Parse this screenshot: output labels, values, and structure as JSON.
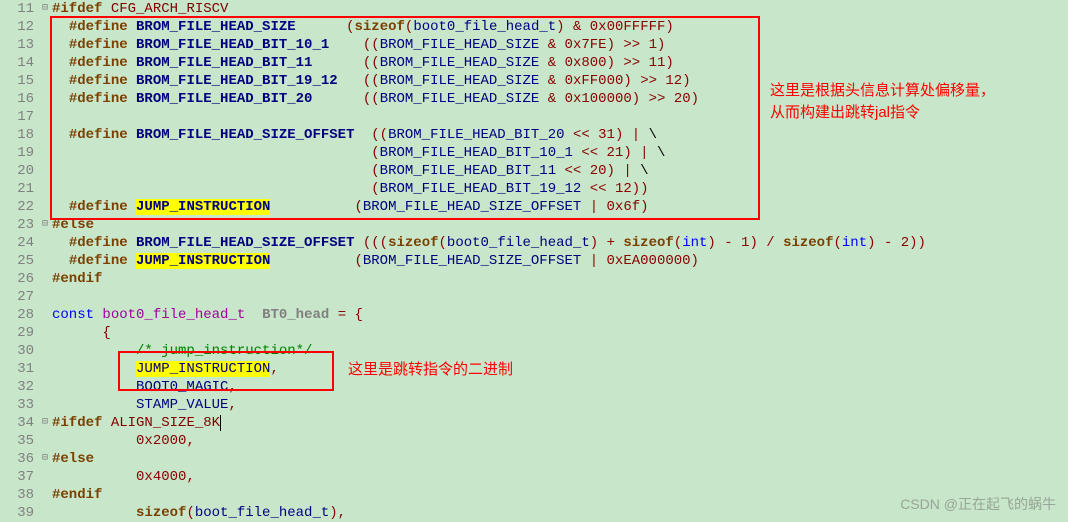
{
  "lines": [
    {
      "n": "11",
      "fold": "⊟",
      "tokens": [
        {
          "c": "kw",
          "t": "#ifdef"
        },
        {
          "c": "txt",
          "t": " "
        },
        {
          "c": "macro",
          "t": "CFG_ARCH_RISCV"
        }
      ]
    },
    {
      "n": "12",
      "fold": "",
      "tokens": [
        {
          "c": "txt",
          "t": "  "
        },
        {
          "c": "kw",
          "t": "#define"
        },
        {
          "c": "txt",
          "t": " "
        },
        {
          "c": "def-name",
          "t": "BROM_FILE_HEAD_SIZE"
        },
        {
          "c": "txt",
          "t": "      "
        },
        {
          "c": "paren",
          "t": "("
        },
        {
          "c": "kw",
          "t": "sizeof"
        },
        {
          "c": "paren",
          "t": "("
        },
        {
          "c": "id",
          "t": "boot0_file_head_t"
        },
        {
          "c": "paren",
          "t": ")"
        },
        {
          "c": "txt",
          "t": " "
        },
        {
          "c": "op",
          "t": "&"
        },
        {
          "c": "txt",
          "t": " "
        },
        {
          "c": "num",
          "t": "0x00FFFFF"
        },
        {
          "c": "paren",
          "t": ")"
        }
      ]
    },
    {
      "n": "13",
      "fold": "",
      "tokens": [
        {
          "c": "txt",
          "t": "  "
        },
        {
          "c": "kw",
          "t": "#define"
        },
        {
          "c": "txt",
          "t": " "
        },
        {
          "c": "def-name",
          "t": "BROM_FILE_HEAD_BIT_10_1"
        },
        {
          "c": "txt",
          "t": "    "
        },
        {
          "c": "paren",
          "t": "(("
        },
        {
          "c": "id",
          "t": "BROM_FILE_HEAD_SIZE"
        },
        {
          "c": "txt",
          "t": " "
        },
        {
          "c": "op",
          "t": "&"
        },
        {
          "c": "txt",
          "t": " "
        },
        {
          "c": "num",
          "t": "0x7FE"
        },
        {
          "c": "paren",
          "t": ")"
        },
        {
          "c": "txt",
          "t": " "
        },
        {
          "c": "op",
          "t": ">>"
        },
        {
          "c": "txt",
          "t": " "
        },
        {
          "c": "num",
          "t": "1"
        },
        {
          "c": "paren",
          "t": ")"
        }
      ]
    },
    {
      "n": "14",
      "fold": "",
      "tokens": [
        {
          "c": "txt",
          "t": "  "
        },
        {
          "c": "kw",
          "t": "#define"
        },
        {
          "c": "txt",
          "t": " "
        },
        {
          "c": "def-name",
          "t": "BROM_FILE_HEAD_BIT_11"
        },
        {
          "c": "txt",
          "t": "      "
        },
        {
          "c": "paren",
          "t": "(("
        },
        {
          "c": "id",
          "t": "BROM_FILE_HEAD_SIZE"
        },
        {
          "c": "txt",
          "t": " "
        },
        {
          "c": "op",
          "t": "&"
        },
        {
          "c": "txt",
          "t": " "
        },
        {
          "c": "num",
          "t": "0x800"
        },
        {
          "c": "paren",
          "t": ")"
        },
        {
          "c": "txt",
          "t": " "
        },
        {
          "c": "op",
          "t": ">>"
        },
        {
          "c": "txt",
          "t": " "
        },
        {
          "c": "num",
          "t": "11"
        },
        {
          "c": "paren",
          "t": ")"
        }
      ]
    },
    {
      "n": "15",
      "fold": "",
      "tokens": [
        {
          "c": "txt",
          "t": "  "
        },
        {
          "c": "kw",
          "t": "#define"
        },
        {
          "c": "txt",
          "t": " "
        },
        {
          "c": "def-name",
          "t": "BROM_FILE_HEAD_BIT_19_12"
        },
        {
          "c": "txt",
          "t": "   "
        },
        {
          "c": "paren",
          "t": "(("
        },
        {
          "c": "id",
          "t": "BROM_FILE_HEAD_SIZE"
        },
        {
          "c": "txt",
          "t": " "
        },
        {
          "c": "op",
          "t": "&"
        },
        {
          "c": "txt",
          "t": " "
        },
        {
          "c": "num",
          "t": "0xFF000"
        },
        {
          "c": "paren",
          "t": ")"
        },
        {
          "c": "txt",
          "t": " "
        },
        {
          "c": "op",
          "t": ">>"
        },
        {
          "c": "txt",
          "t": " "
        },
        {
          "c": "num",
          "t": "12"
        },
        {
          "c": "paren",
          "t": ")"
        }
      ]
    },
    {
      "n": "16",
      "fold": "",
      "tokens": [
        {
          "c": "txt",
          "t": "  "
        },
        {
          "c": "kw",
          "t": "#define"
        },
        {
          "c": "txt",
          "t": " "
        },
        {
          "c": "def-name",
          "t": "BROM_FILE_HEAD_BIT_20"
        },
        {
          "c": "txt",
          "t": "      "
        },
        {
          "c": "paren",
          "t": "(("
        },
        {
          "c": "id",
          "t": "BROM_FILE_HEAD_SIZE"
        },
        {
          "c": "txt",
          "t": " "
        },
        {
          "c": "op",
          "t": "&"
        },
        {
          "c": "txt",
          "t": " "
        },
        {
          "c": "num",
          "t": "0x100000"
        },
        {
          "c": "paren",
          "t": ")"
        },
        {
          "c": "txt",
          "t": " "
        },
        {
          "c": "op",
          "t": ">>"
        },
        {
          "c": "txt",
          "t": " "
        },
        {
          "c": "num",
          "t": "20"
        },
        {
          "c": "paren",
          "t": ")"
        }
      ]
    },
    {
      "n": "17",
      "fold": "",
      "tokens": []
    },
    {
      "n": "18",
      "fold": "",
      "tokens": [
        {
          "c": "txt",
          "t": "  "
        },
        {
          "c": "kw",
          "t": "#define"
        },
        {
          "c": "txt",
          "t": " "
        },
        {
          "c": "def-name",
          "t": "BROM_FILE_HEAD_SIZE_OFFSET"
        },
        {
          "c": "txt",
          "t": "  "
        },
        {
          "c": "paren",
          "t": "(("
        },
        {
          "c": "id",
          "t": "BROM_FILE_HEAD_BIT_20"
        },
        {
          "c": "txt",
          "t": " "
        },
        {
          "c": "op",
          "t": "<<"
        },
        {
          "c": "txt",
          "t": " "
        },
        {
          "c": "num",
          "t": "31"
        },
        {
          "c": "paren",
          "t": ")"
        },
        {
          "c": "txt",
          "t": " "
        },
        {
          "c": "op",
          "t": "|"
        },
        {
          "c": "txt",
          "t": " \\"
        }
      ]
    },
    {
      "n": "19",
      "fold": "",
      "tokens": [
        {
          "c": "txt",
          "t": "                                      "
        },
        {
          "c": "paren",
          "t": "("
        },
        {
          "c": "id",
          "t": "BROM_FILE_HEAD_BIT_10_1"
        },
        {
          "c": "txt",
          "t": " "
        },
        {
          "c": "op",
          "t": "<<"
        },
        {
          "c": "txt",
          "t": " "
        },
        {
          "c": "num",
          "t": "21"
        },
        {
          "c": "paren",
          "t": ")"
        },
        {
          "c": "txt",
          "t": " "
        },
        {
          "c": "op",
          "t": "|"
        },
        {
          "c": "txt",
          "t": " \\"
        }
      ]
    },
    {
      "n": "20",
      "fold": "",
      "tokens": [
        {
          "c": "txt",
          "t": "                                      "
        },
        {
          "c": "paren",
          "t": "("
        },
        {
          "c": "id",
          "t": "BROM_FILE_HEAD_BIT_11"
        },
        {
          "c": "txt",
          "t": " "
        },
        {
          "c": "op",
          "t": "<<"
        },
        {
          "c": "txt",
          "t": " "
        },
        {
          "c": "num",
          "t": "20"
        },
        {
          "c": "paren",
          "t": ")"
        },
        {
          "c": "txt",
          "t": " "
        },
        {
          "c": "op",
          "t": "|"
        },
        {
          "c": "txt",
          "t": " \\"
        }
      ]
    },
    {
      "n": "21",
      "fold": "",
      "tokens": [
        {
          "c": "txt",
          "t": "                                      "
        },
        {
          "c": "paren",
          "t": "("
        },
        {
          "c": "id",
          "t": "BROM_FILE_HEAD_BIT_19_12"
        },
        {
          "c": "txt",
          "t": " "
        },
        {
          "c": "op",
          "t": "<<"
        },
        {
          "c": "txt",
          "t": " "
        },
        {
          "c": "num",
          "t": "12"
        },
        {
          "c": "paren",
          "t": "))"
        }
      ]
    },
    {
      "n": "22",
      "fold": "",
      "tokens": [
        {
          "c": "txt",
          "t": "  "
        },
        {
          "c": "kw",
          "t": "#define"
        },
        {
          "c": "txt",
          "t": " "
        },
        {
          "c": "def-name hl",
          "t": "JUMP_INSTRUCTION"
        },
        {
          "c": "txt",
          "t": "          "
        },
        {
          "c": "paren",
          "t": "("
        },
        {
          "c": "id",
          "t": "BROM_FILE_HEAD_SIZE_OFFSET"
        },
        {
          "c": "txt",
          "t": " "
        },
        {
          "c": "op",
          "t": "|"
        },
        {
          "c": "txt",
          "t": " "
        },
        {
          "c": "num",
          "t": "0x6f"
        },
        {
          "c": "paren",
          "t": ")"
        }
      ]
    },
    {
      "n": "23",
      "fold": "⊟",
      "tokens": [
        {
          "c": "kw",
          "t": "#else"
        }
      ]
    },
    {
      "n": "24",
      "fold": "",
      "tokens": [
        {
          "c": "txt",
          "t": "  "
        },
        {
          "c": "kw",
          "t": "#define"
        },
        {
          "c": "txt",
          "t": " "
        },
        {
          "c": "def-name",
          "t": "BROM_FILE_HEAD_SIZE_OFFSET"
        },
        {
          "c": "txt",
          "t": " "
        },
        {
          "c": "paren",
          "t": "((("
        },
        {
          "c": "kw",
          "t": "sizeof"
        },
        {
          "c": "paren",
          "t": "("
        },
        {
          "c": "id",
          "t": "boot0_file_head_t"
        },
        {
          "c": "paren",
          "t": ")"
        },
        {
          "c": "txt",
          "t": " "
        },
        {
          "c": "op",
          "t": "+"
        },
        {
          "c": "txt",
          "t": " "
        },
        {
          "c": "kw",
          "t": "sizeof"
        },
        {
          "c": "paren",
          "t": "("
        },
        {
          "c": "qual",
          "t": "int"
        },
        {
          "c": "paren",
          "t": ")"
        },
        {
          "c": "txt",
          "t": " "
        },
        {
          "c": "op",
          "t": "-"
        },
        {
          "c": "txt",
          "t": " "
        },
        {
          "c": "num",
          "t": "1"
        },
        {
          "c": "paren",
          "t": ")"
        },
        {
          "c": "txt",
          "t": " "
        },
        {
          "c": "op",
          "t": "/"
        },
        {
          "c": "txt",
          "t": " "
        },
        {
          "c": "kw",
          "t": "sizeof"
        },
        {
          "c": "paren",
          "t": "("
        },
        {
          "c": "qual",
          "t": "int"
        },
        {
          "c": "paren",
          "t": ")"
        },
        {
          "c": "txt",
          "t": " "
        },
        {
          "c": "op",
          "t": "-"
        },
        {
          "c": "txt",
          "t": " "
        },
        {
          "c": "num",
          "t": "2"
        },
        {
          "c": "paren",
          "t": "))"
        }
      ]
    },
    {
      "n": "25",
      "fold": "",
      "tokens": [
        {
          "c": "txt",
          "t": "  "
        },
        {
          "c": "kw",
          "t": "#define"
        },
        {
          "c": "txt",
          "t": " "
        },
        {
          "c": "def-name hl",
          "t": "JUMP_INSTRUCTION"
        },
        {
          "c": "txt",
          "t": "          "
        },
        {
          "c": "paren",
          "t": "("
        },
        {
          "c": "id",
          "t": "BROM_FILE_HEAD_SIZE_OFFSET"
        },
        {
          "c": "txt",
          "t": " "
        },
        {
          "c": "op",
          "t": "|"
        },
        {
          "c": "txt",
          "t": " "
        },
        {
          "c": "num",
          "t": "0xEA000000"
        },
        {
          "c": "paren",
          "t": ")"
        }
      ]
    },
    {
      "n": "26",
      "fold": "",
      "tokens": [
        {
          "c": "kw",
          "t": "#endif"
        }
      ]
    },
    {
      "n": "27",
      "fold": "",
      "tokens": []
    },
    {
      "n": "28",
      "fold": "",
      "tokens": [
        {
          "c": "qual",
          "t": "const"
        },
        {
          "c": "txt",
          "t": " "
        },
        {
          "c": "type",
          "t": "boot0_file_head_t"
        },
        {
          "c": "txt",
          "t": "  "
        },
        {
          "c": "var",
          "t": "BT0_head"
        },
        {
          "c": "txt",
          "t": " "
        },
        {
          "c": "op",
          "t": "="
        },
        {
          "c": "txt",
          "t": " "
        },
        {
          "c": "paren",
          "t": "{"
        }
      ]
    },
    {
      "n": "29",
      "fold": "",
      "tokens": [
        {
          "c": "txt",
          "t": "      "
        },
        {
          "c": "paren",
          "t": "{"
        }
      ]
    },
    {
      "n": "30",
      "fold": "",
      "tokens": [
        {
          "c": "txt",
          "t": "          "
        },
        {
          "c": "comment",
          "t": "/* jump_instruction*/"
        }
      ]
    },
    {
      "n": "31",
      "fold": "",
      "tokens": [
        {
          "c": "txt",
          "t": "          "
        },
        {
          "c": "id hl",
          "t": "JUMP_INSTRUCTION"
        },
        {
          "c": "op",
          "t": ","
        }
      ]
    },
    {
      "n": "32",
      "fold": "",
      "tokens": [
        {
          "c": "txt",
          "t": "          "
        },
        {
          "c": "id",
          "t": "BOOT0_MAGIC"
        },
        {
          "c": "op",
          "t": ","
        }
      ]
    },
    {
      "n": "33",
      "fold": "",
      "tokens": [
        {
          "c": "txt",
          "t": "          "
        },
        {
          "c": "id",
          "t": "STAMP_VALUE"
        },
        {
          "c": "op",
          "t": ","
        }
      ]
    },
    {
      "n": "34",
      "fold": "⊟",
      "tokens": [
        {
          "c": "kw",
          "t": "#ifdef"
        },
        {
          "c": "txt",
          "t": " "
        },
        {
          "c": "macro",
          "t": "ALIGN_SIZE_8K"
        },
        {
          "c": "cursor",
          "t": ""
        }
      ]
    },
    {
      "n": "35",
      "fold": "",
      "tokens": [
        {
          "c": "txt",
          "t": "          "
        },
        {
          "c": "num",
          "t": "0x2000"
        },
        {
          "c": "op",
          "t": ","
        }
      ]
    },
    {
      "n": "36",
      "fold": "⊟",
      "tokens": [
        {
          "c": "kw",
          "t": "#else"
        }
      ]
    },
    {
      "n": "37",
      "fold": "",
      "tokens": [
        {
          "c": "txt",
          "t": "          "
        },
        {
          "c": "num",
          "t": "0x4000"
        },
        {
          "c": "op",
          "t": ","
        }
      ]
    },
    {
      "n": "38",
      "fold": "",
      "tokens": [
        {
          "c": "kw",
          "t": "#endif"
        }
      ]
    },
    {
      "n": "39",
      "fold": "",
      "tokens": [
        {
          "c": "txt",
          "t": "          "
        },
        {
          "c": "kw",
          "t": "sizeof"
        },
        {
          "c": "paren",
          "t": "("
        },
        {
          "c": "id",
          "t": "boot_file_head_t"
        },
        {
          "c": "paren",
          "t": ")"
        },
        {
          "c": "op",
          "t": ","
        }
      ]
    }
  ],
  "annotation1_line1": "这里是根据头信息计算处偏移量，",
  "annotation1_line2": "从而构建出跳转jal指令",
  "annotation2": "这里是跳转指令的二进制",
  "watermark": "CSDN @正在起飞的蜗牛"
}
